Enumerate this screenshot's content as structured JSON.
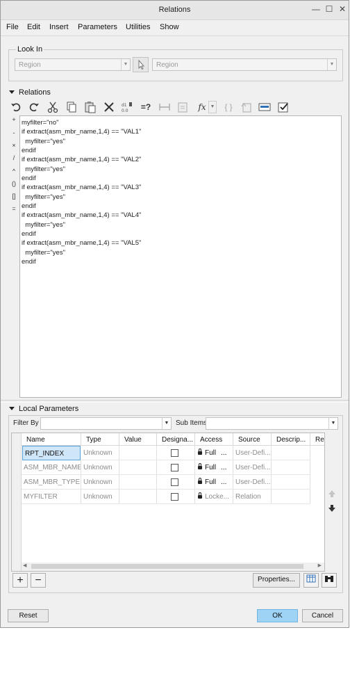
{
  "window": {
    "title": "Relations",
    "controls": {
      "minimize": "—",
      "maximize": "☐",
      "close": "✕"
    }
  },
  "menu": [
    "File",
    "Edit",
    "Insert",
    "Parameters",
    "Utilities",
    "Show"
  ],
  "look_in": {
    "label": "Look In",
    "type_value": "Region",
    "item_value": "Region"
  },
  "relations": {
    "label": "Relations",
    "toolbar": [
      "undo-icon",
      "redo-icon",
      "cut-icon",
      "copy-icon",
      "paste-icon",
      "delete-icon",
      "sort-icon",
      "evaluate-icon",
      "measure-icon",
      "verify-icon",
      "function-icon",
      "function-dropdown-icon",
      "brackets-icon",
      "param-icon",
      "units-icon",
      "check-icon"
    ],
    "operators": [
      "+",
      "-",
      "×",
      "/",
      "^",
      "()",
      "[]",
      "="
    ],
    "code": "myfilter=\"no\"\nif extract(asm_mbr_name,1,4) == \"VAL1\"\n  myfilter=\"yes\"\nendif\nif extract(asm_mbr_name,1,4) == \"VAL2\"\n  myfilter=\"yes\"\nendif\nif extract(asm_mbr_name,1,4) == \"VAL3\"\n  myfilter=\"yes\"\nendif\nif extract(asm_mbr_name,1,4) == \"VAL4\"\n  myfilter=\"yes\"\nendif\nif extract(asm_mbr_name,1,4) == \"VAL5\"\n  myfilter=\"yes\"\nendif"
  },
  "local_params": {
    "label": "Local Parameters",
    "filter_label": "Filter By",
    "filter_value": "",
    "subitems_label": "Sub Items",
    "subitems_value": "",
    "columns": [
      "Name",
      "Type",
      "Value",
      "Designa...",
      "Access",
      "Source",
      "Descrip...",
      "Res"
    ],
    "rows": [
      {
        "name": "RPT_INDEX",
        "type": "Unknown",
        "value": "",
        "access": "Full",
        "ellipsis": "...",
        "source": "User-Defi..."
      },
      {
        "name": "ASM_MBR_NAME",
        "type": "Unknown",
        "value": "",
        "access": "Full",
        "ellipsis": "...",
        "source": "User-Defi..."
      },
      {
        "name": "ASM_MBR_TYPE",
        "type": "Unknown",
        "value": "",
        "access": "Full",
        "ellipsis": "...",
        "source": "User-Defi..."
      },
      {
        "name": "MYFILTER",
        "type": "Unknown",
        "value": "",
        "access": "Locke...",
        "ellipsis": "",
        "source": "Relation"
      }
    ],
    "add_label": "+",
    "remove_label": "−",
    "properties_label": "Properties..."
  },
  "footer": {
    "reset": "Reset",
    "ok": "OK",
    "cancel": "Cancel"
  }
}
